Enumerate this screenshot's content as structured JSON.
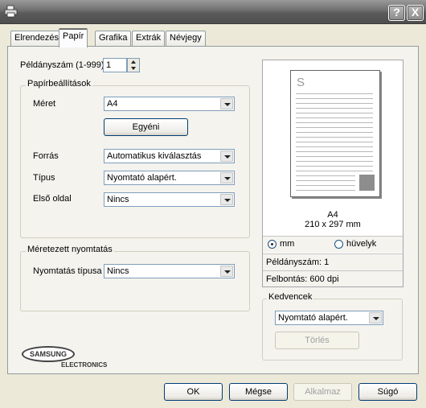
{
  "window": {
    "help_label": "?",
    "close_label": "X"
  },
  "tabs": [
    {
      "label": "Elrendezés"
    },
    {
      "label": "Papír"
    },
    {
      "label": "Grafika"
    },
    {
      "label": "Extrák"
    },
    {
      "label": "Névjegy"
    }
  ],
  "copies": {
    "label": "Példányszám (1-999)",
    "value": "1"
  },
  "paper_settings": {
    "legend": "Papírbeállítások",
    "size_label": "Méret",
    "size_value": "A4",
    "custom_button": "Egyéni",
    "source_label": "Forrás",
    "source_value": "Automatikus kiválasztás",
    "type_label": "Típus",
    "type_value": "Nyomtató alapért.",
    "first_page_label": "Első oldal",
    "first_page_value": "Nincs"
  },
  "scaled_printing": {
    "legend": "Méretezett nyomtatás",
    "type_label": "Nyomtatás típusa",
    "type_value": "Nincs"
  },
  "preview": {
    "page_letter": "S",
    "paper_name": "A4",
    "paper_dims": "210 x 297 mm",
    "unit_mm": "mm",
    "unit_inch": "hüvelyk",
    "selected_unit": "mm",
    "copies_text": "Példányszám: 1",
    "resolution_text": "Felbontás: 600 dpi"
  },
  "favorites": {
    "legend": "Kedvencek",
    "value": "Nyomtató alapért.",
    "delete_button": "Törlés"
  },
  "logo": {
    "brand": "SAMSUNG",
    "sub": "ELECTRONICS"
  },
  "footer": {
    "ok": "OK",
    "cancel": "Mégse",
    "apply": "Alkalmaz",
    "help": "Súgó"
  }
}
